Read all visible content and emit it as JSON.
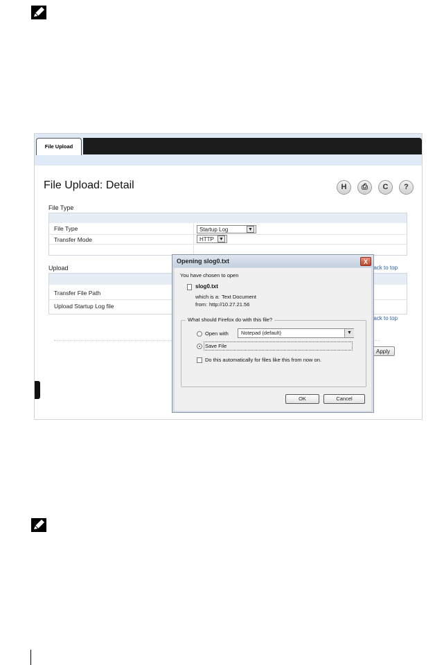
{
  "tab": {
    "label": "File Upload"
  },
  "page": {
    "title": "File Upload: Detail"
  },
  "toolbar": {
    "save": "H",
    "print": "⎙",
    "refresh": "C",
    "help": "?"
  },
  "file_type_section": {
    "label": "File Type",
    "rows": [
      {
        "label": "File Type",
        "value": "Startup Log"
      },
      {
        "label": "Transfer Mode",
        "value": "HTTP"
      }
    ]
  },
  "upload_section": {
    "label": "Upload",
    "rows": [
      {
        "label": "Transfer File Path"
      },
      {
        "label": "Upload Startup Log file"
      }
    ]
  },
  "links": {
    "back_to_top_1": "Back to top",
    "back_to_top_2": "Back to top"
  },
  "apply_label": "Apply",
  "dialog": {
    "title": "Opening slog0.txt",
    "close": "X",
    "intro": "You have chosen to open",
    "filename": "slog0.txt",
    "which_is_label": "which is a:",
    "which_is_value": "Text Document",
    "from_label": "from:",
    "from_value": "http://10.27.21.56",
    "question": "What should Firefox do with this file?",
    "open_with_label": "Open with",
    "open_with_app": "Notepad (default)",
    "save_file_label": "Save File",
    "auto_label": "Do this automatically for files like this from now on.",
    "ok": "OK",
    "cancel": "Cancel",
    "selected_option": "save_file",
    "auto_checked": false
  }
}
